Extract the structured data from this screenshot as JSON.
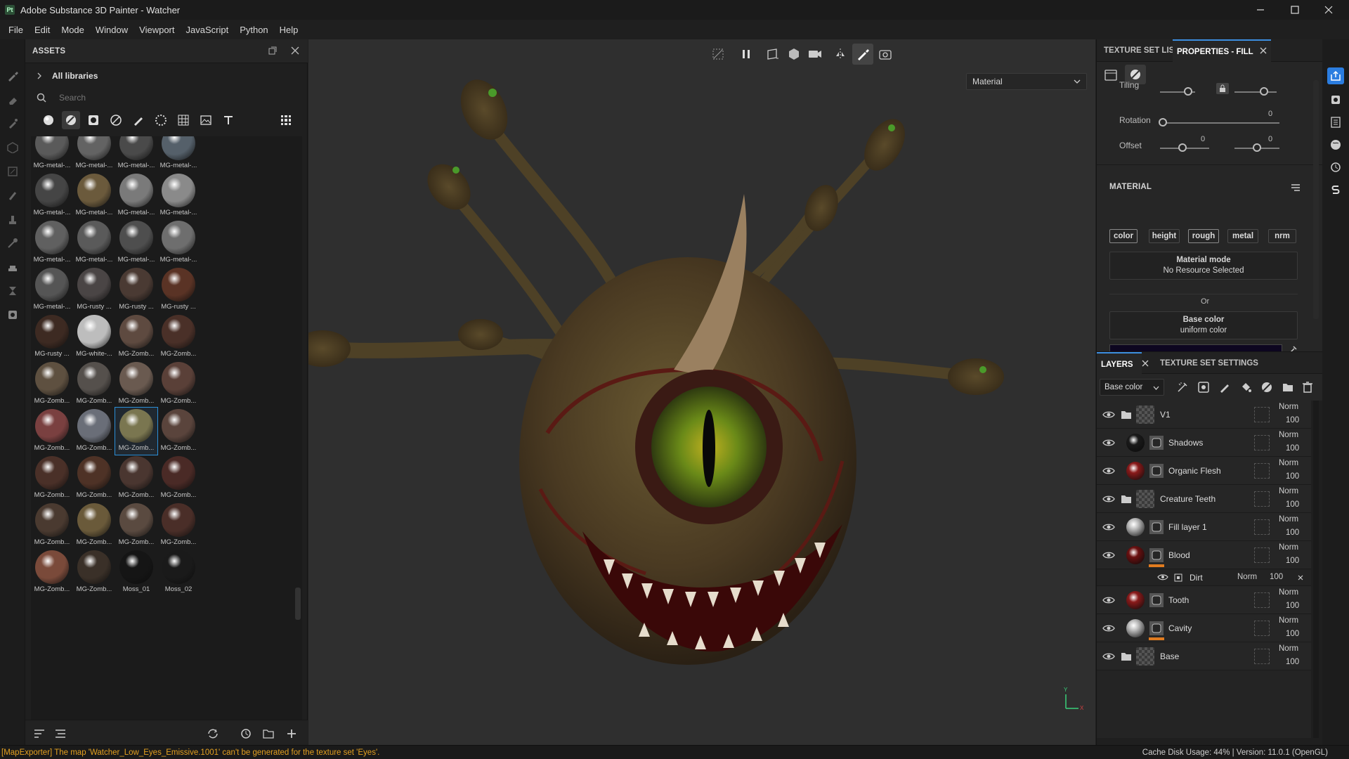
{
  "window": {
    "app_icon": "Pt",
    "title": "Adobe Substance 3D Painter - Watcher",
    "controls": [
      "minimize-icon",
      "maximize-icon",
      "close-icon"
    ]
  },
  "menu": [
    "File",
    "Edit",
    "Mode",
    "Window",
    "Viewport",
    "JavaScript",
    "Python",
    "Help"
  ],
  "assets": {
    "title": "ASSETS",
    "library": "All libraries",
    "search_placeholder": "Search",
    "filters": [
      "material-sphere-icon",
      "smart-material-icon",
      "mask-icon",
      "filter-icon",
      "brush-icon",
      "particles-icon",
      "alpha-icon",
      "environment-icon",
      "text-icon"
    ],
    "items": [
      {
        "label": "MG-metal-...",
        "color": "#5a5a5a"
      },
      {
        "label": "MG-metal-...",
        "color": "#636363"
      },
      {
        "label": "MG-metal-...",
        "color": "#4a4a4a"
      },
      {
        "label": "MG-metal-...",
        "color": "#55606a"
      },
      {
        "label": "MG-metal-...",
        "color": "#454545"
      },
      {
        "label": "MG-metal-...",
        "color": "#6b5a3c"
      },
      {
        "label": "MG-metal-...",
        "color": "#7a7a7a"
      },
      {
        "label": "MG-metal-...",
        "color": "#8a8a8a"
      },
      {
        "label": "MG-metal-...",
        "color": "#606060"
      },
      {
        "label": "MG-metal-...",
        "color": "#5a5a5a"
      },
      {
        "label": "MG-metal-...",
        "color": "#4e4e4e"
      },
      {
        "label": "MG-metal-...",
        "color": "#6e6e6e"
      },
      {
        "label": "MG-metal-...",
        "color": "#555555"
      },
      {
        "label": "MG-rusty ...",
        "color": "#4a4545"
      },
      {
        "label": "MG-rusty ...",
        "color": "#4a3a33"
      },
      {
        "label": "MG-rusty ...",
        "color": "#5a3325"
      },
      {
        "label": "MG-rusty ...",
        "color": "#3d2a22"
      },
      {
        "label": "MG-white-...",
        "color": "#bdbdbd"
      },
      {
        "label": "MG-Zomb...",
        "color": "#5e4a40"
      },
      {
        "label": "MG-Zomb...",
        "color": "#4a3028"
      },
      {
        "label": "MG-Zomb...",
        "color": "#5e5040"
      },
      {
        "label": "MG-Zomb...",
        "color": "#55504c"
      },
      {
        "label": "MG-Zomb...",
        "color": "#6a5a50"
      },
      {
        "label": "MG-Zomb...",
        "color": "#5a4038"
      },
      {
        "label": "MG-Zomb...",
        "color": "#7a4040"
      },
      {
        "label": "MG-Zomb...",
        "color": "#6a6e78"
      },
      {
        "label": "MG-Zomb...",
        "color": "#7a7650"
      },
      {
        "label": "MG-Zomb...",
        "color": "#5a443c"
      },
      {
        "label": "MG-Zomb...",
        "color": "#4a3028"
      },
      {
        "label": "MG-Zomb...",
        "color": "#4e3226"
      },
      {
        "label": "MG-Zomb...",
        "color": "#4a3630"
      },
      {
        "label": "MG-Zomb...",
        "color": "#4a2a26"
      },
      {
        "label": "MG-Zomb...",
        "color": "#4a3a30"
      },
      {
        "label": "MG-Zomb...",
        "color": "#6a5a3a"
      },
      {
        "label": "MG-Zomb...",
        "color": "#5a4a40"
      },
      {
        "label": "MG-Zomb...",
        "color": "#4a2e28"
      },
      {
        "label": "MG-Zomb...",
        "color": "#7a4a3a"
      },
      {
        "label": "MG-Zomb...",
        "color": "#3a3028"
      },
      {
        "label": "Moss_01",
        "color": "#151515"
      },
      {
        "label": "Moss_02",
        "color": "#1a1a1a"
      }
    ],
    "selected_index": 26
  },
  "viewport": {
    "material_mode": "Material",
    "toolbar_icons": [
      "hide-ui-icon",
      "pause-icon",
      "view-2d-icon",
      "view-3d-icon",
      "camera-icon",
      "symmetry-icon",
      "paint-icon",
      "screenshot-icon"
    ],
    "axes": {
      "y": "Y",
      "x": "X"
    }
  },
  "right": {
    "tab_texture_set_list": "TEXTURE SET LIST",
    "tab_properties": "PROPERTIES - FILL",
    "tiling_label": "Tiling",
    "rotation_label": "Rotation",
    "rotation_value": "0",
    "offset_label": "Offset",
    "offset_value_1": "0",
    "offset_value_2": "0",
    "material_section": "MATERIAL",
    "channels": [
      {
        "label": "color",
        "on": true
      },
      {
        "label": "height",
        "on": false
      },
      {
        "label": "rough",
        "on": true
      },
      {
        "label": "metal",
        "on": false
      },
      {
        "label": "nrm",
        "on": false
      }
    ],
    "material_mode_title": "Material mode",
    "material_mode_value": "No Resource Selected",
    "or_text": "Or",
    "base_color_title": "Base color",
    "base_color_value": "uniform color",
    "base_color_swatch": "#0d0620",
    "tab_layers": "LAYERS",
    "tab_texture_set_settings": "TEXTURE SET SETTINGS",
    "channel_select": "Base color"
  },
  "layers": [
    {
      "name": "V1",
      "type": "folder",
      "blend": "Norm",
      "opacity": "100",
      "thumb": "#4a4a4a"
    },
    {
      "name": "Shadows",
      "type": "fill",
      "blend": "Norm",
      "opacity": "100",
      "thumb": "#1a1a1a"
    },
    {
      "name": "Organic Flesh",
      "type": "fill",
      "blend": "Norm",
      "opacity": "100",
      "thumb": "#8a1a1a"
    },
    {
      "name": "Creature Teeth",
      "type": "folder",
      "blend": "Norm",
      "opacity": "100",
      "thumb": "#4a4a4a"
    },
    {
      "name": "Fill layer 1",
      "type": "fill",
      "blend": "Norm",
      "opacity": "100",
      "thumb": "#bdbdbd"
    },
    {
      "name": "Blood",
      "type": "fill",
      "blend": "Norm",
      "opacity": "100",
      "thumb": "#6a1010"
    },
    {
      "name": "Tooth",
      "type": "fill",
      "blend": "Norm",
      "opacity": "100",
      "thumb": "#8a1a1a"
    },
    {
      "name": "Cavity",
      "type": "fill",
      "blend": "Norm",
      "opacity": "100",
      "thumb": "#bdbdbd"
    },
    {
      "name": "Base",
      "type": "folder",
      "blend": "Norm",
      "opacity": "100",
      "thumb": "#4a4a4a"
    }
  ],
  "sublayer": {
    "name": "Dirt",
    "blend": "Norm",
    "opacity": "100"
  },
  "status": {
    "message": "[MapExporter] The map 'Watcher_Low_Eyes_Emissive.1001' can't be generated for the texture set 'Eyes'.",
    "right": "Cache Disk Usage:   44% | Version: 11.0.1 (OpenGL)"
  }
}
